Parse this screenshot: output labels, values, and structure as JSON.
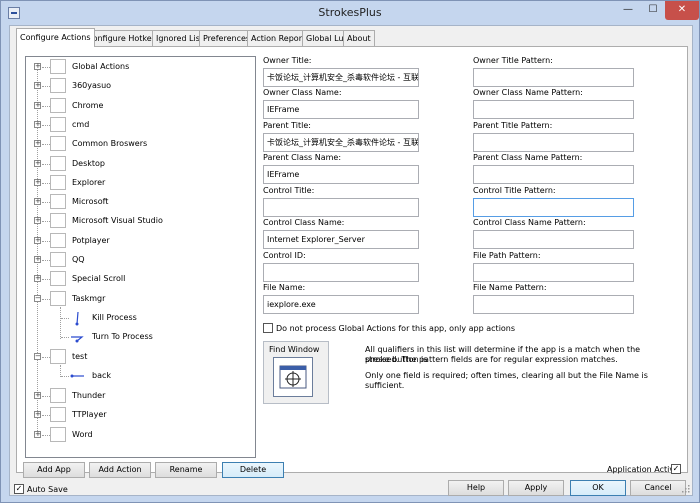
{
  "window": {
    "title": "StrokesPlus",
    "min_glyph": "—",
    "max_glyph": "☐",
    "close_glyph": "✕"
  },
  "tabs": [
    {
      "label": "Configure Actions",
      "active": true
    },
    {
      "label": "Configure Hotkeys"
    },
    {
      "label": "Ignored List"
    },
    {
      "label": "Preferences"
    },
    {
      "label": "Action Report"
    },
    {
      "label": "Global Lua"
    },
    {
      "label": "About"
    }
  ],
  "tree": {
    "expand_glyph": "+",
    "collapse_glyph": "−",
    "items": [
      {
        "label": "Global Actions"
      },
      {
        "label": "360yasuo"
      },
      {
        "label": "Chrome"
      },
      {
        "label": "cmd"
      },
      {
        "label": "Common Broswers"
      },
      {
        "label": "Desktop"
      },
      {
        "label": "Explorer"
      },
      {
        "label": "Microsoft"
      },
      {
        "label": "Microsoft Visual Studio"
      },
      {
        "label": "Potplayer"
      },
      {
        "label": "QQ"
      },
      {
        "label": "Special Scroll"
      },
      {
        "label": "Taskmgr"
      },
      {
        "label": "Kill Process"
      },
      {
        "label": "Turn To Process"
      },
      {
        "label": "test"
      },
      {
        "label": "back"
      },
      {
        "label": "Thunder"
      },
      {
        "label": "TTPlayer"
      },
      {
        "label": "Word"
      }
    ]
  },
  "fields_left": [
    {
      "label": "Owner Title:",
      "value": "卡饭论坛_计算机安全_杀毒软件论坛 - 互联"
    },
    {
      "label": "Owner Class Name:",
      "value": "IEFrame"
    },
    {
      "label": "Parent Title:",
      "value": "卡饭论坛_计算机安全_杀毒软件论坛 - 互联"
    },
    {
      "label": "Parent Class Name:",
      "value": "IEFrame"
    },
    {
      "label": "Control Title:",
      "value": ""
    },
    {
      "label": "Control Class Name:",
      "value": "Internet Explorer_Server"
    },
    {
      "label": "Control ID:",
      "value": ""
    },
    {
      "label": "File Name:",
      "value": "iexplore.exe"
    }
  ],
  "fields_right": [
    {
      "label": "Owner Title Pattern:",
      "value": ""
    },
    {
      "label": "Owner Class Name Pattern:",
      "value": ""
    },
    {
      "label": "Parent Title Pattern:",
      "value": ""
    },
    {
      "label": "Parent Class Name Pattern:",
      "value": ""
    },
    {
      "label": "Control Title Pattern:",
      "value": ""
    },
    {
      "label": "Control Class Name Pattern:",
      "value": ""
    },
    {
      "label": "File Path Pattern:",
      "value": ""
    },
    {
      "label": "File Name Pattern:",
      "value": ""
    }
  ],
  "global_actions_checkbox": {
    "label": "Do not process Global Actions for this app, only app actions",
    "checked": false
  },
  "find_window": {
    "label": "Find Window"
  },
  "info": {
    "line1": "All qualifiers in this list will determine if the app is a match when the stroke button is",
    "line2": "pressed. The pattern fields are for regular expression matches.",
    "line3": "Only one field is required; often times, clearing all but the File Name is sufficient."
  },
  "tree_buttons": {
    "add_app": "Add App",
    "add_action": "Add Action",
    "rename": "Rename",
    "delete": "Delete"
  },
  "application_active": {
    "label": "Application Active",
    "checked": true
  },
  "auto_save": {
    "label": "Auto Save",
    "checked": true
  },
  "bottom_buttons": {
    "help": "Help",
    "apply": "Apply",
    "ok": "OK",
    "cancel": "Cancel"
  },
  "check_glyph": "✓"
}
